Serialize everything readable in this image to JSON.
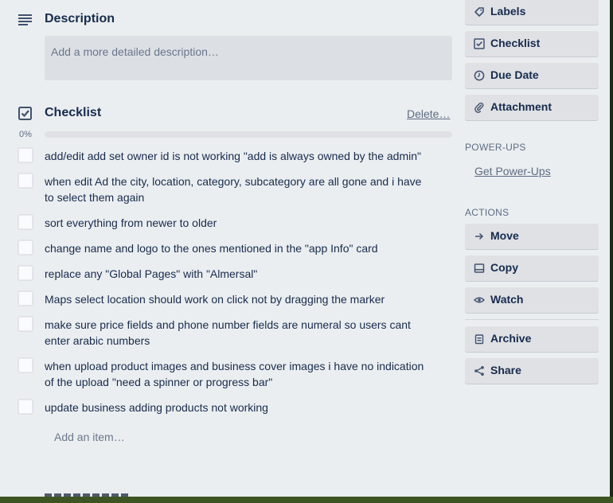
{
  "description": {
    "title": "Description",
    "placeholder": "Add a more detailed description…"
  },
  "checklist": {
    "title": "Checklist",
    "delete_label": "Delete…",
    "progress_label": "0%",
    "progress_fraction": 0,
    "items": [
      {
        "text": "add/edit add set owner id is not working \"add is always owned by the admin\"",
        "checked": false
      },
      {
        "text": "when edit Ad the city, location, category, subcategory are all gone and i have to select them again",
        "checked": false
      },
      {
        "text": "sort everything from newer to older",
        "checked": false
      },
      {
        "text": "change name and logo to the ones mentioned in the \"app Info\" card",
        "checked": false
      },
      {
        "text": "replace any \"Global Pages\" with \"Almersal\"",
        "checked": false
      },
      {
        "text": "Maps select location should work on click not by dragging the marker",
        "checked": false
      },
      {
        "text": "make sure price fields and phone number fields are numeral so users cant enter arabic numbers",
        "checked": false
      },
      {
        "text": "when upload product images and business cover images i have no indication of the upload \"need a spinner or progress bar\"",
        "checked": false
      },
      {
        "text": "update business adding products not working",
        "checked": false
      }
    ],
    "add_item_label": "Add an item…"
  },
  "sidebar": {
    "add_buttons": [
      {
        "label": "Labels",
        "icon": "tag-icon"
      },
      {
        "label": "Checklist",
        "icon": "checklist-icon"
      },
      {
        "label": "Due Date",
        "icon": "clock-icon"
      },
      {
        "label": "Attachment",
        "icon": "paperclip-icon"
      }
    ],
    "powerups_heading": "POWER-UPS",
    "powerups_link": "Get Power-Ups",
    "actions_heading": "ACTIONS",
    "actions": [
      {
        "label": "Move",
        "icon": "arrow-right-icon"
      },
      {
        "label": "Copy",
        "icon": "card-icon"
      },
      {
        "label": "Watch",
        "icon": "eye-icon"
      },
      {
        "label": "Archive",
        "icon": "archive-icon"
      },
      {
        "label": "Share",
        "icon": "share-icon"
      }
    ]
  },
  "colors": {
    "card_background": "#ebeef0",
    "button_background": "#dfe1e5",
    "text_primary": "#172b4d",
    "text_muted": "#5e6c84",
    "progress_fill": "#5aac44"
  }
}
